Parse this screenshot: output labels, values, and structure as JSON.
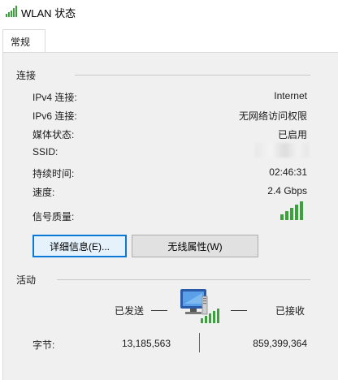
{
  "window": {
    "title": "WLAN 状态"
  },
  "tabs": [
    {
      "label": "常规"
    }
  ],
  "connection": {
    "section_title": "连接",
    "rows": [
      {
        "label": "IPv4 连接:",
        "value": "Internet"
      },
      {
        "label": "IPv6 连接:",
        "value": "无网络访问权限"
      },
      {
        "label": "媒体状态:",
        "value": "已启用"
      },
      {
        "label": "SSID:",
        "value": ""
      },
      {
        "label": "持续时间:",
        "value": "02:46:31"
      },
      {
        "label": "速度:",
        "value": "2.4 Gbps"
      },
      {
        "label": "信号质量:",
        "value": ""
      }
    ],
    "signal_level": 1.0
  },
  "buttons": {
    "details": "详细信息(E)...",
    "wireless_properties": "无线属性(W)"
  },
  "activity": {
    "section_title": "活动",
    "sent_label": "已发送",
    "received_label": "已接收",
    "bytes_label": "字节:",
    "bytes_sent": "13,185,563",
    "bytes_received": "859,399,364"
  },
  "colors": {
    "signal_green": "#3aa23a",
    "button_focus_border": "#0a78d7",
    "panel_bg": "#f0f0f0"
  },
  "icons": {
    "title_icon": "wifi-signal-icon",
    "signal_icon": "signal-bars-icon",
    "activity_icon": "network-computer-icon"
  }
}
